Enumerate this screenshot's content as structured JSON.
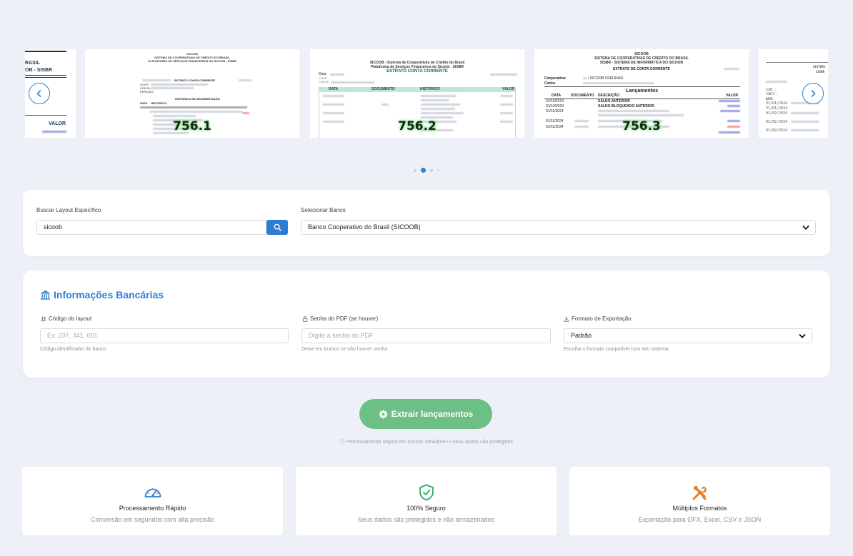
{
  "carousel": {
    "slides": [
      {
        "label": ""
      },
      {
        "label": "756.1",
        "header": [
          "SICOOB",
          "SISTEMA DE COOPERATIVAS DE CRÉDITO DO BRASIL",
          "PLATAFORMA DE SERVIÇOS FINANCEIROS DO SICOOB - SISBR"
        ],
        "subtitle": "EXTRATO CONTA CORRENTE",
        "section": "HISTÓRICO DE MOVIMENTAÇÃO",
        "fields": [
          "COOP.:",
          "CONTA:",
          "PERÍODO:"
        ],
        "cols": [
          "DATA",
          "HISTÓRICO"
        ]
      },
      {
        "label": "756.2",
        "header": [
          "SICOOB - Sistema de Cooperativas de Crédito do Brasil",
          "Plataforma de Serviços Financeiros do Sicoob - SISBR"
        ],
        "subtitle": "EXTRATO CONTA CORRENTE",
        "fields": [
          "Data",
          "COOP.",
          "CONTA"
        ],
        "cols": [
          "DATA",
          "DOCUMENTO",
          "HISTÓRICO",
          "VALOR"
        ]
      },
      {
        "label": "756.3",
        "header": [
          "SICOOB",
          "SISTEMA DE COOPERATIVAS DE CRÉDITO DO BRASIL",
          "SISBR - SISTEMA DE INFORMÁTICA DO SICOOB"
        ],
        "subtitle": "EXTRATO DE CONTA CORRENTE",
        "fields": [
          "Cooperativa:",
          "Conta:"
        ],
        "coop_value": "/ SICOOB CREDIVAR",
        "section": "Lançamentos",
        "cols": [
          "DATA",
          "DOCUMENTO",
          "DESCRIÇÃO",
          "VALOR"
        ],
        "rows": [
          {
            "date": "31/10/2024",
            "desc": "SALDO ANTERIOR"
          },
          {
            "date": "31/10/2024",
            "desc": "SALDO BLOQUEADO ANTERIOR"
          },
          {
            "date": "01/11/2024",
            "desc": ""
          },
          {
            "date": "01/11/2024",
            "desc": ""
          },
          {
            "date": "01/11/2024",
            "desc": ""
          }
        ]
      },
      {
        "label": "",
        "header": [
          "SISTEMA",
          "SISBR"
        ],
        "fields": [
          "COOP :",
          "CONTA :"
        ],
        "cols": [
          "DATA"
        ],
        "dates": [
          "31/01/2024",
          "31/01/2024",
          "01/02/2024",
          "01/02/2024",
          "01/02/2024"
        ]
      }
    ],
    "partial_left": {
      "lines": [
        "RASIL",
        "OB - SISBR"
      ],
      "col": "VALOR"
    },
    "prev_icon": "chevron-left-icon",
    "next_icon": "chevron-right-icon",
    "dots": 4,
    "active_dot": 1
  },
  "search": {
    "label": "Buscar Layout Específico",
    "value": "sicoob",
    "button_icon": "search-icon",
    "bank_label": "Selecionar Banco",
    "bank_value": "Banco Cooperativo do Brasil (SICOOB)"
  },
  "bank_info": {
    "title": "Informações Bancárias",
    "title_icon": "bank-icon",
    "layout_code": {
      "label": "Código do layout",
      "icon": "hash-icon",
      "placeholder": "Ex: 237, 341, 001",
      "hint": "Código identificador do banco"
    },
    "pdf_password": {
      "label": "Senha do PDF (se houver)",
      "icon": "lock-icon",
      "placeholder": "Digite a senha do PDF",
      "hint": "Deixe em branco se não houver senha"
    },
    "export_format": {
      "label": "Formato de Exportação",
      "icon": "download-icon",
      "value": "Padrão",
      "hint": "Escolha o formato compatível com seu sistema"
    }
  },
  "extract": {
    "label": "Extrair lançamentos",
    "icon": "gear-icon",
    "note": "ⓘ Processamento seguro em nossos servidores • Seus dados são protegidos"
  },
  "features": [
    {
      "icon": "speedometer-icon",
      "title": "Processamento Rápido",
      "desc": "Conversão em segundos com alta precisão",
      "color": "#2f7fd6"
    },
    {
      "icon": "shield-check-icon",
      "title": "100% Seguro",
      "desc": "Seus dados são protegidos e não armazenados",
      "color": "#27ae60"
    },
    {
      "icon": "tools-icon",
      "title": "Múltiplos Formatos",
      "desc": "Exportação para OFX, Excel, CSV e JSON",
      "color": "#e67e22"
    }
  ]
}
